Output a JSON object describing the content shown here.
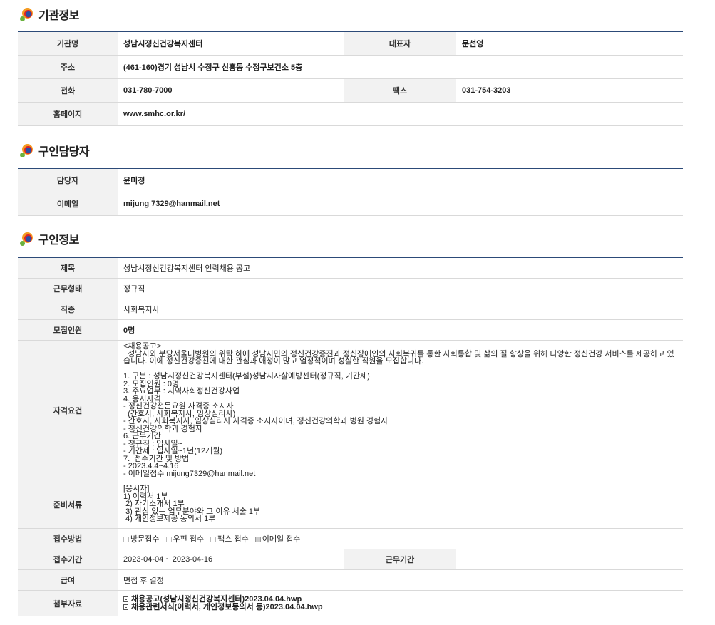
{
  "sections": {
    "org": {
      "title": "기관정보",
      "rows": {
        "name_label": "기관명",
        "name_value": "성남시정신건강복지센터",
        "rep_label": "대표자",
        "rep_value": "문선영",
        "addr_label": "주소",
        "addr_value": "(461-160)경기 성남시 수정구 신흥동 수정구보건소 5층",
        "tel_label": "전화",
        "tel_value": "031-780-7000",
        "fax_label": "팩스",
        "fax_value": "031-754-3203",
        "home_label": "홈페이지",
        "home_value": "www.smhc.or.kr/"
      }
    },
    "contact": {
      "title": "구인담당자",
      "rows": {
        "person_label": "담당자",
        "person_value": "윤미정",
        "email_label": "이메일",
        "email_value": "mijung 7329@hanmail.net"
      }
    },
    "job": {
      "title": "구인정보",
      "rows": {
        "title_label": "제목",
        "title_value": "성남시정신건강복지센터 인력채용 공고",
        "type_label": "근무형태",
        "type_value": "정규직",
        "kind_label": "직종",
        "kind_value": "사회복지사",
        "count_label": "모집인원",
        "count_value": "0명",
        "qual_label": "자격요건",
        "qual_value": "<채용공고>\n  성남시와 분당서울대병원의 위탁 하에 성남시민의 정신건강증진과 정신장애인의 사회복귀를 통한 사회통합 및 삶의 질 향상을 위해 다양한 정신건강 서비스를 제공하고 있습니다. 이에 정신건강증진에 대한 관심과 애정이 많고 열정적이며 성실한 직원을 모집합니다.\n\n1. 구분 : 성남시정신건강복지센터(부설)성남시자살예방센터(정규직, 기간제)\n2. 모집인원 : 0명\n3. 주요업무 : 지역사회정신건강사업\n4. 응시자격\n- 정신건강전문요원 자격증 소지자\n  (간호사, 사회복지사, 임상심리사)\n- 간호사, 사회복지사, 임상심리사 자격증 소지자이며, 정신건강의학과 병원 경험자\n- 정신건강의학과 경험자\n6. 근무기간\n- 정규직 : 입사일~\n- 기간제 : 입사일~1년(12개월)\n7.  접수기간 및 방법\n- 2023.4.4~4.16\n- 이메일접수 mijung7329@hanmail.net",
        "docs_label": "준비서류",
        "docs_value": "[응시자]\n1) 이력서 1부\n 2) 자기소개서 1부\n 3) 관심 있는 업무분야와 그 이유 서술 1부\n 4) 개인정보제공 동의서 1부",
        "method_label": "접수방법",
        "methods": [
          {
            "label": "방문접수",
            "checked": false
          },
          {
            "label": "우편 접수",
            "checked": false
          },
          {
            "label": "팩스 접수",
            "checked": false
          },
          {
            "label": "이메일 접수",
            "checked": true
          }
        ],
        "period_label": "접수기간",
        "period_value": "2023-04-04 ~ 2023-04-16",
        "workperiod_label": "근무기간",
        "workperiod_value": "",
        "pay_label": "급여",
        "pay_value": "면접 후 결정",
        "attach_label": "첨부자료",
        "attachments": [
          "채용공고(성남시정신건강복지센터)2023.04.04.hwp",
          "채용관련서식(이력서, 개인정보동의서 등)2023.04.04.hwp"
        ]
      }
    }
  }
}
